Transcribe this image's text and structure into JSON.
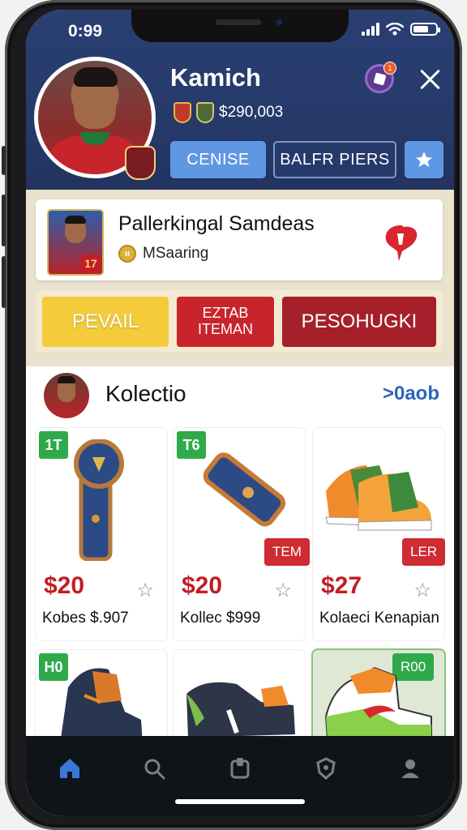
{
  "status_bar": {
    "time": "0:99"
  },
  "profile": {
    "username": "Kamich",
    "balance": "$290,003",
    "notification_count": "1",
    "buttons": {
      "primary": "CENISE",
      "secondary": "BALFR PIERS"
    }
  },
  "promo": {
    "title": "Pallerkingal Samdeas",
    "subtitle": "MSaaring",
    "card_number": "17",
    "actions": [
      "PEVAIL",
      "EZTAB ITEMAN",
      "PESOHUGKI"
    ]
  },
  "collection": {
    "title": "Kolectio",
    "more_link": ">0aob",
    "items": [
      {
        "tag": "1T",
        "price": "$20",
        "name": "Kobes $.907",
        "corner": ""
      },
      {
        "tag": "T6",
        "price": "$20",
        "name": "Kollec $999",
        "corner": "TEM"
      },
      {
        "tag": "",
        "price": "$27",
        "name": "Kolaeci Kenapian",
        "corner": "LER"
      },
      {
        "tag": "H0",
        "price": "",
        "name": "",
        "corner": ""
      },
      {
        "tag": "",
        "price": "",
        "name": "",
        "corner": ""
      },
      {
        "tag": "",
        "price": "",
        "name": "",
        "corner": "R00"
      }
    ]
  },
  "nav": [
    "home",
    "search",
    "collection",
    "badge",
    "profile"
  ],
  "colors": {
    "header": "#263a6a",
    "accent_blue": "#5f97e3",
    "accent_red": "#c8242c",
    "accent_yellow": "#f4cc3b",
    "tag_green": "#2faa4a"
  }
}
